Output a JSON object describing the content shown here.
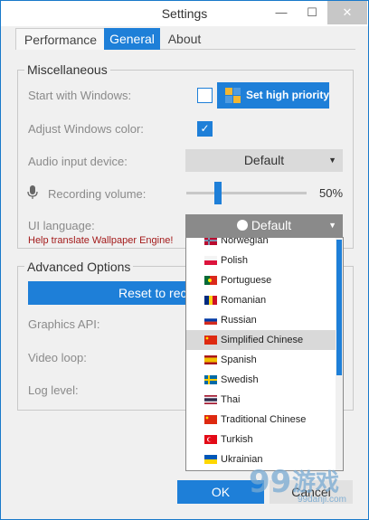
{
  "window": {
    "title": "Settings",
    "minimize": "—",
    "maximize": "☐",
    "close": "✕"
  },
  "tabs": [
    {
      "label": "Performance"
    },
    {
      "label": "General",
      "active": true
    },
    {
      "label": "About"
    }
  ],
  "misc": {
    "title": "Miscellaneous",
    "start_with_windows": {
      "label": "Start with Windows:",
      "checked": false
    },
    "priority_button": "Set high priority",
    "adjust_color": {
      "label": "Adjust Windows color:",
      "checked": true,
      "check_glyph": "✓"
    },
    "audio_input": {
      "label": "Audio input device:",
      "value": "Default"
    },
    "recording_volume": {
      "label": "Recording volume:",
      "value_text": "50%",
      "level": 0.25
    },
    "ui_language": {
      "label": "UI language:",
      "value": "Default"
    },
    "help_link": "Help translate Wallpaper Engine!"
  },
  "advanced": {
    "title": "Advanced Options",
    "reset_button": "Reset to rec",
    "graphics_api_label": "Graphics API:",
    "video_loop_label": "Video loop:",
    "log_level_label": "Log level:"
  },
  "language_dropdown": {
    "items": [
      {
        "label": "Norwegian",
        "flag": "norway-flag-icon"
      },
      {
        "label": "Polish",
        "flag": "poland-flag-icon"
      },
      {
        "label": "Portuguese",
        "flag": "portugal-flag-icon"
      },
      {
        "label": "Romanian",
        "flag": "romania-flag-icon"
      },
      {
        "label": "Russian",
        "flag": "russia-flag-icon"
      },
      {
        "label": "Simplified Chinese",
        "flag": "china-flag-icon",
        "highlighted": true
      },
      {
        "label": "Spanish",
        "flag": "spain-flag-icon"
      },
      {
        "label": "Swedish",
        "flag": "sweden-flag-icon"
      },
      {
        "label": "Thai",
        "flag": "thailand-flag-icon"
      },
      {
        "label": "Traditional Chinese",
        "flag": "taiwan-flag-icon"
      },
      {
        "label": "Turkish",
        "flag": "turkey-flag-icon"
      },
      {
        "label": "Ukrainian",
        "flag": "ukraine-flag-icon"
      }
    ]
  },
  "footer": {
    "ok": "OK",
    "cancel": "Cancel"
  },
  "watermark": {
    "number": "99",
    "text": "游戏",
    "url": "99danji.com"
  },
  "colors": {
    "accent": "#1e7fd8",
    "help_text": "#a31a1a"
  }
}
